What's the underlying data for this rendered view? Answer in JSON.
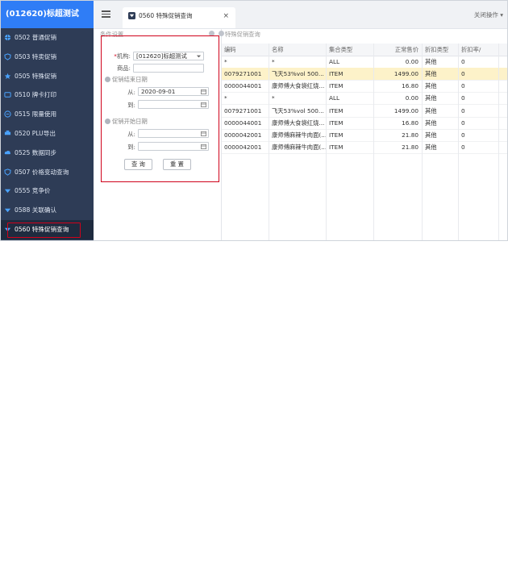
{
  "brand": "(012620)标超测试",
  "sidebar": {
    "items": [
      {
        "label": "0502 普通促销",
        "icon": "globe-icon"
      },
      {
        "label": "0503 特卖促销",
        "icon": "shield-icon"
      },
      {
        "label": "0505 特殊促销",
        "icon": "star-icon"
      },
      {
        "label": "0510 牌卡打印",
        "icon": "tag-icon"
      },
      {
        "label": "0515 限量使用",
        "icon": "list-icon"
      },
      {
        "label": "0520 PLU导出",
        "icon": "printer-icon"
      },
      {
        "label": "0525 数据同步",
        "icon": "cloud-icon"
      },
      {
        "label": "0507 价格变动查询",
        "icon": "shield-icon"
      },
      {
        "label": "0555 竞争价",
        "icon": "diamond-icon"
      },
      {
        "label": "0588 关联确认",
        "icon": "diamond-icon"
      },
      {
        "label": "0560 特殊促销查询",
        "icon": "diamond-icon",
        "active": true
      }
    ]
  },
  "topbar": {
    "tab_label": "0560 特殊促销查询",
    "tab_close": "×",
    "close_ops": "关闭操作 ▾"
  },
  "filter": {
    "section_title": "条件设置",
    "org_label": "机构:",
    "org_required": "*",
    "org_value": "[012620]标超测试",
    "product_label": "商品:",
    "product_value": "",
    "end_section": "促销结束日期",
    "start_section": "促销开始日期",
    "from_label": "从:",
    "to_label": "到:",
    "end_from_value": "2020-09-01",
    "end_to_value": "",
    "start_from_value": "",
    "start_to_value": "",
    "query_button": "查 询",
    "reset_button": "重 置"
  },
  "results": {
    "title": "特殊促销查询",
    "columns": [
      "编码",
      "名称",
      "集合类型",
      "正常售价",
      "折扣类型",
      "折扣率/"
    ],
    "rows": [
      [
        "*",
        "*",
        "ALL",
        "0.00",
        "其他",
        "0"
      ],
      [
        "0079271001",
        "飞天53%vol 500...",
        "ITEM",
        "1499.00",
        "其他",
        "0"
      ],
      [
        "0000044001",
        "康师傅大食袋红烧...",
        "ITEM",
        "16.80",
        "其他",
        "0"
      ],
      [
        "*",
        "*",
        "ALL",
        "0.00",
        "其他",
        "0"
      ],
      [
        "0079271001",
        "飞天53%vol 500...",
        "ITEM",
        "1499.00",
        "其他",
        "0"
      ],
      [
        "0000044001",
        "康师傅大食袋红烧...",
        "ITEM",
        "16.80",
        "其他",
        "0"
      ],
      [
        "0000042001",
        "康师傅麻辣牛肉面(...",
        "ITEM",
        "21.80",
        "其他",
        "0"
      ],
      [
        "0000042001",
        "康师傅麻辣牛肉面(...",
        "ITEM",
        "21.80",
        "其他",
        "0"
      ]
    ],
    "selected_row": 1
  },
  "colors": {
    "brand_bg": "#2f7df6",
    "sidebar_bg": "#2e3c56",
    "highlight": "#d0021b",
    "selected_row": "#fdf2c9"
  }
}
